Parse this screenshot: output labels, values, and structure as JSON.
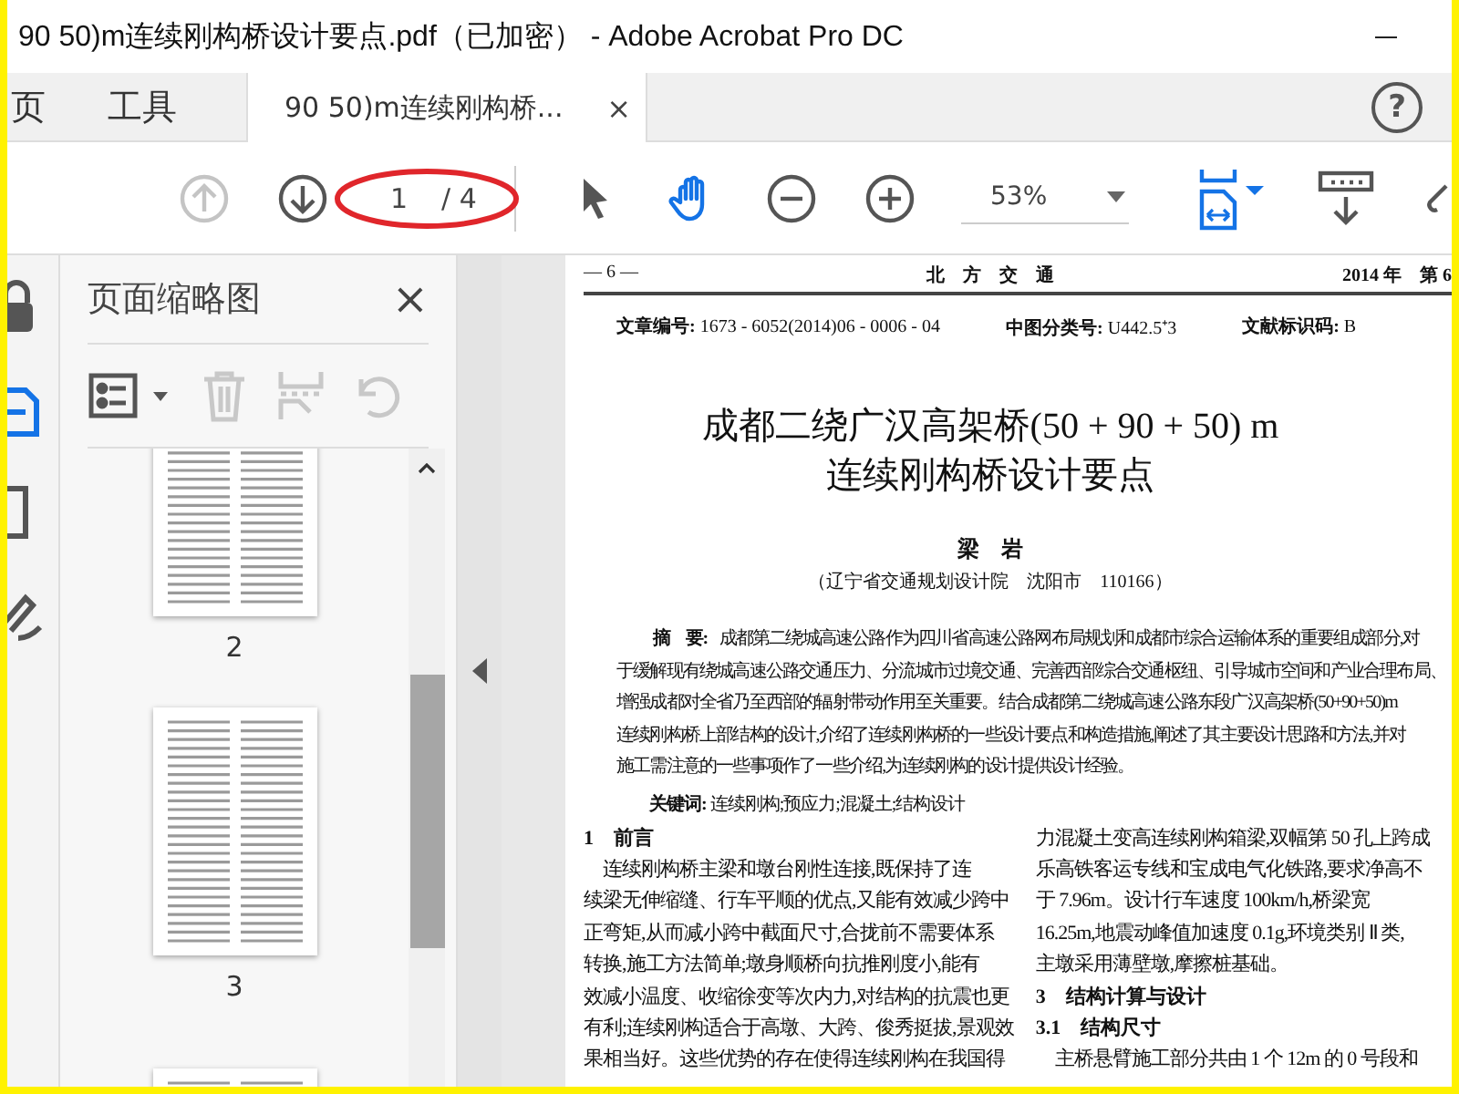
{
  "window": {
    "title": "90 50)m连续刚构桥设计要点.pdf（已加密） - Adobe Acrobat Pro DC"
  },
  "tabs": [
    {
      "label": "页",
      "kind": "plain",
      "selected": false
    },
    {
      "label": "工具",
      "kind": "plain",
      "selected": false
    },
    {
      "label": "90 50)m连续刚构桥...",
      "kind": "document",
      "close": "×",
      "selected": true
    }
  ],
  "help": "?",
  "toolbar": {
    "nav": [
      {
        "kind": "up",
        "disabled": true
      },
      {
        "kind": "down",
        "disabled": false
      }
    ],
    "page_field": {
      "value": "1",
      "total": "/ 4"
    },
    "tools": [
      {
        "kind": "pointer",
        "selected": false
      },
      {
        "kind": "hand",
        "selected": true
      },
      {
        "kind": "zoom-out",
        "selected": false
      },
      {
        "kind": "zoom-in",
        "selected": false
      }
    ],
    "zoom": "53%"
  },
  "side_rail": [
    {
      "kind": "lock",
      "selected": false
    },
    {
      "kind": "pages",
      "selected": true
    },
    {
      "kind": "bookmark",
      "selected": false
    },
    {
      "kind": "sign",
      "selected": false
    }
  ],
  "thumbnail_panel": {
    "title": "页面缩略图",
    "close": "×",
    "tools": [
      {
        "kind": "options",
        "disabled": false
      },
      {
        "kind": "delete",
        "disabled": true
      },
      {
        "kind": "extract",
        "disabled": true
      },
      {
        "kind": "rotate",
        "disabled": true
      }
    ],
    "thumbnails": [
      {
        "kind": "full",
        "label": "2"
      },
      {
        "kind": "full",
        "label": "3"
      },
      {
        "kind": "cut"
      }
    ]
  },
  "document": {
    "header": {
      "left": "— 6 —",
      "center": "北　方　交　通",
      "right": "2014 年　第 6"
    },
    "meta": [
      "**文章编号:** 1673 - 6052(2014)06 - 0006 - 04",
      "**中图分类号:** U442.5⁺3",
      "**文献标识码:** B"
    ],
    "title_lines": [
      "成都二绕广汉高架桥(50 + 90 + 50) m",
      "连续刚构桥设计要点"
    ],
    "author": "梁　岩",
    "affiliation": "（辽宁省交通规划设计院　沈阳市　110166）",
    "abstract_lines": [
      "**摘　要:** 成都第二绕城高速公路作为四川省高速公路网布局规划和成都市综合运输体系的重要组成部分,对",
      "于缓解现有绕城高速公路交通压力、分流城市过境交通、完善西部综合交通枢纽、引导城市空间和产业合理布局、",
      "增强成都对全省乃至西部的辐射带动作用至关重要。结合成都第二绕城高速公路东段广汉高架桥(50+90+50)m",
      "连续刚构桥上部结构的设计,介绍了连续刚构桥的一些设计要点和构造措施,阐述了其主要设计思路和方法,并对",
      "施工需注意的一些事项作了一些介绍,为连续刚构的设计提供设计经验。"
    ],
    "keywords": "**关键词:** 连续刚构;预应力;混凝土;结构设计",
    "left_column": [
      {
        "kind": "heading",
        "text": "1　前言"
      },
      {
        "kind": "paragraph",
        "lines": [
          "　连续刚构桥主梁和墩台刚性连接,既保持了连",
          "续梁无伸缩缝、行车平顺的优点,又能有效减少跨中",
          "正弯矩,从而减小跨中截面尺寸,合拢前不需要体系",
          "转换,施工方法简单;墩身顺桥向抗推刚度小,能有",
          "效减小温度、收缩徐变等次内力,对结构的抗震也更",
          "有利;连续刚构适合于高墩、大跨、俊秀挺拔,景观效",
          "果相当好。这些优势的存在使得连续刚构在我国得"
        ]
      }
    ],
    "right_column": [
      {
        "kind": "paragraph",
        "lines": [
          "力混凝土变高连续刚构箱梁,双幅第 50 孔上跨成",
          "乐高铁客运专线和宝成电气化铁路,要求净高不",
          "于 7.96m。设计行车速度 100km/h,桥梁宽",
          "16.25m,地震动峰值加速度 0.1g,环境类别 Ⅱ 类,",
          "主墩采用薄壁墩,摩擦桩基础。"
        ]
      },
      {
        "kind": "heading",
        "text": "3　结构计算与设计"
      },
      {
        "kind": "heading",
        "text": "3.1　结构尺寸"
      },
      {
        "kind": "paragraph",
        "lines": [
          "　主桥悬臂施工部分共由 1 个 12m 的 0 号段和"
        ]
      }
    ]
  }
}
